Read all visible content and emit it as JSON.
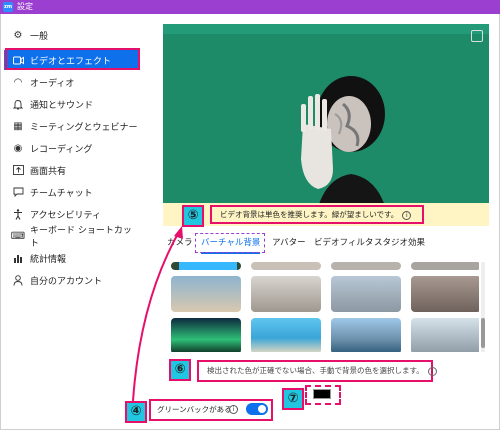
{
  "window": {
    "title": "設定",
    "logo": "zm"
  },
  "sidebar": {
    "items": [
      {
        "label": "一般",
        "icon": "gear-icon",
        "glyph": "⚙"
      },
      {
        "label": "ビデオとエフェクト",
        "icon": "video-icon",
        "glyph": "▭"
      },
      {
        "label": "オーディオ",
        "icon": "headphones-icon",
        "glyph": "◠"
      },
      {
        "label": "通知とサウンド",
        "icon": "bell-icon",
        "glyph": "♫"
      },
      {
        "label": "ミーティングとウェビナー",
        "icon": "meeting-icon",
        "glyph": "▦"
      },
      {
        "label": "レコーディング",
        "icon": "record-icon",
        "glyph": "◉"
      },
      {
        "label": "画面共有",
        "icon": "share-screen-icon",
        "glyph": "⬆"
      },
      {
        "label": "チームチャット",
        "icon": "chat-icon",
        "glyph": "▢"
      },
      {
        "label": "アクセシビリティ",
        "icon": "accessibility-icon",
        "glyph": "✝"
      },
      {
        "label": "キーボード ショートカット",
        "icon": "keyboard-icon",
        "glyph": "⌨"
      },
      {
        "label": "統計情報",
        "icon": "stats-icon",
        "glyph": "▮"
      },
      {
        "label": "自分のアカウント",
        "icon": "account-icon",
        "glyph": "◯"
      }
    ],
    "active_index": 1
  },
  "preview": {
    "warning": "ビデオ背景は単色を推奨します。緑が望ましいです。",
    "info_glyph": "i"
  },
  "tabs": [
    "カメラ",
    "バーチャル背景",
    "アバター",
    "ビデオフィルタ",
    "スタジオ効果"
  ],
  "active_tab": 1,
  "thumbnails": [
    "mirror-logo",
    "beach-hut",
    "office-room",
    "living-room",
    "city-view",
    "lounge",
    "aurora",
    "tropical-beach",
    "mountain-lake",
    "window-room"
  ],
  "detect_text": "検出された色が正確でない場合、手動で背景の色を選択します。",
  "green_screen": {
    "label": "グリーンバックがある",
    "enabled": true
  },
  "badges": {
    "b4": "④",
    "b5": "⑤",
    "b6": "⑥",
    "b7": "⑦"
  },
  "colors": {
    "accent": "#0e71eb",
    "highlight": "#e6106a",
    "title_bar": "#9a3fcf",
    "badge": "#21c6e0",
    "green_bg": "#1d8a68"
  }
}
